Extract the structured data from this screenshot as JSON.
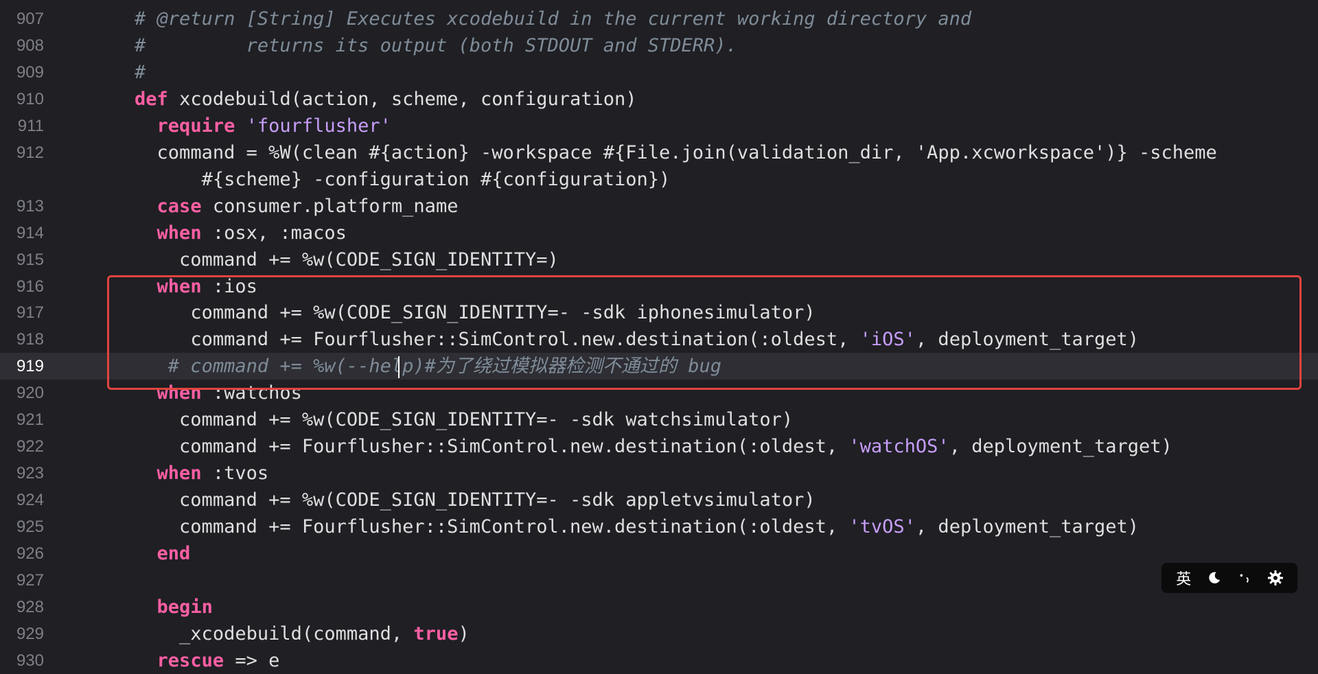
{
  "editor": {
    "current_line": "919",
    "lines": [
      {
        "num": "907",
        "indent": "    ",
        "segments": [
          {
            "t": "# @return [String] Executes xcodebuild in the current working directory and",
            "c": "cmt"
          }
        ]
      },
      {
        "num": "908",
        "indent": "    ",
        "segments": [
          {
            "t": "#         returns its output (both STDOUT and STDERR).",
            "c": "cmt"
          }
        ]
      },
      {
        "num": "909",
        "indent": "    ",
        "segments": [
          {
            "t": "#",
            "c": "cmt"
          }
        ]
      },
      {
        "num": "910",
        "indent": "    ",
        "segments": [
          {
            "t": "def",
            "c": "kw"
          },
          {
            "t": " xcodebuild(action, scheme, configuration)",
            "c": ""
          }
        ]
      },
      {
        "num": "911",
        "indent": "      ",
        "segments": [
          {
            "t": "require",
            "c": "kw"
          },
          {
            "t": " ",
            "c": ""
          },
          {
            "t": "'fourflusher'",
            "c": "str"
          }
        ]
      },
      {
        "num": "912",
        "indent": "      ",
        "segments": [
          {
            "t": "command = %W(clean #{action} -workspace #{File.join(validation_dir, 'App.xcworkspace')} -scheme",
            "c": ""
          }
        ]
      },
      {
        "num": "",
        "indent": "          ",
        "segments": [
          {
            "t": "#{scheme} -configuration #{configuration})",
            "c": ""
          }
        ]
      },
      {
        "num": "913",
        "indent": "      ",
        "segments": [
          {
            "t": "case",
            "c": "kw"
          },
          {
            "t": " consumer.platform_name",
            "c": ""
          }
        ]
      },
      {
        "num": "914",
        "indent": "      ",
        "segments": [
          {
            "t": "when",
            "c": "kw"
          },
          {
            "t": " :osx, :macos",
            "c": ""
          }
        ]
      },
      {
        "num": "915",
        "indent": "        ",
        "segments": [
          {
            "t": "command += %w(CODE_SIGN_IDENTITY=)",
            "c": ""
          }
        ]
      },
      {
        "num": "916",
        "indent": "      ",
        "segments": [
          {
            "t": "when",
            "c": "kw"
          },
          {
            "t": " :ios",
            "c": ""
          }
        ]
      },
      {
        "num": "917",
        "indent": "         ",
        "segments": [
          {
            "t": "command += %w(CODE_SIGN_IDENTITY=- -sdk iphonesimulator)",
            "c": ""
          }
        ]
      },
      {
        "num": "918",
        "indent": "         ",
        "segments": [
          {
            "t": "command += Fourflusher::SimControl.new.destination(:oldest, ",
            "c": ""
          },
          {
            "t": "'iOS'",
            "c": "str"
          },
          {
            "t": ", deployment_target)",
            "c": ""
          }
        ]
      },
      {
        "num": "919",
        "indent": "       ",
        "segments": [
          {
            "t": "# command += %w(--help)#",
            "c": "cmt"
          },
          {
            "t": "为了绕过模拟器检测不通过的",
            "c": "cmt han"
          },
          {
            "t": " bug",
            "c": "cmt"
          }
        ]
      },
      {
        "num": "920",
        "indent": "      ",
        "segments": [
          {
            "t": "when",
            "c": "kw"
          },
          {
            "t": " :watchos",
            "c": ""
          }
        ]
      },
      {
        "num": "921",
        "indent": "        ",
        "segments": [
          {
            "t": "command += %w(CODE_SIGN_IDENTITY=- -sdk watchsimulator)",
            "c": ""
          }
        ]
      },
      {
        "num": "922",
        "indent": "        ",
        "segments": [
          {
            "t": "command += Fourflusher::SimControl.new.destination(:oldest, ",
            "c": ""
          },
          {
            "t": "'watchOS'",
            "c": "str"
          },
          {
            "t": ", deployment_target)",
            "c": ""
          }
        ]
      },
      {
        "num": "923",
        "indent": "      ",
        "segments": [
          {
            "t": "when",
            "c": "kw"
          },
          {
            "t": " :tvos",
            "c": ""
          }
        ]
      },
      {
        "num": "924",
        "indent": "        ",
        "segments": [
          {
            "t": "command += %w(CODE_SIGN_IDENTITY=- -sdk appletvsimulator)",
            "c": ""
          }
        ]
      },
      {
        "num": "925",
        "indent": "        ",
        "segments": [
          {
            "t": "command += Fourflusher::SimControl.new.destination(:oldest, ",
            "c": ""
          },
          {
            "t": "'tvOS'",
            "c": "str"
          },
          {
            "t": ", deployment_target)",
            "c": ""
          }
        ]
      },
      {
        "num": "926",
        "indent": "      ",
        "segments": [
          {
            "t": "end",
            "c": "kw"
          }
        ]
      },
      {
        "num": "927",
        "indent": "",
        "segments": []
      },
      {
        "num": "928",
        "indent": "      ",
        "segments": [
          {
            "t": "begin",
            "c": "kw"
          }
        ]
      },
      {
        "num": "929",
        "indent": "        ",
        "segments": [
          {
            "t": "_xcodebuild(command, ",
            "c": ""
          },
          {
            "t": "true",
            "c": "kw"
          },
          {
            "t": ")",
            "c": ""
          }
        ]
      },
      {
        "num": "930",
        "indent": "      ",
        "segments": [
          {
            "t": "rescue",
            "c": "kw"
          },
          {
            "t": " => e",
            "c": ""
          }
        ]
      }
    ]
  },
  "ime_toolbar": {
    "lang_label": "英",
    "moon_icon": "moon-icon",
    "punct_icon": "punctuation-icon",
    "gear_icon": "gear-icon"
  },
  "colors": {
    "background": "#1f1f24",
    "keyword": "#fc5fa3",
    "string": "#c79ef9",
    "comment": "#7f8c98",
    "highlight_border": "#e0443e"
  }
}
